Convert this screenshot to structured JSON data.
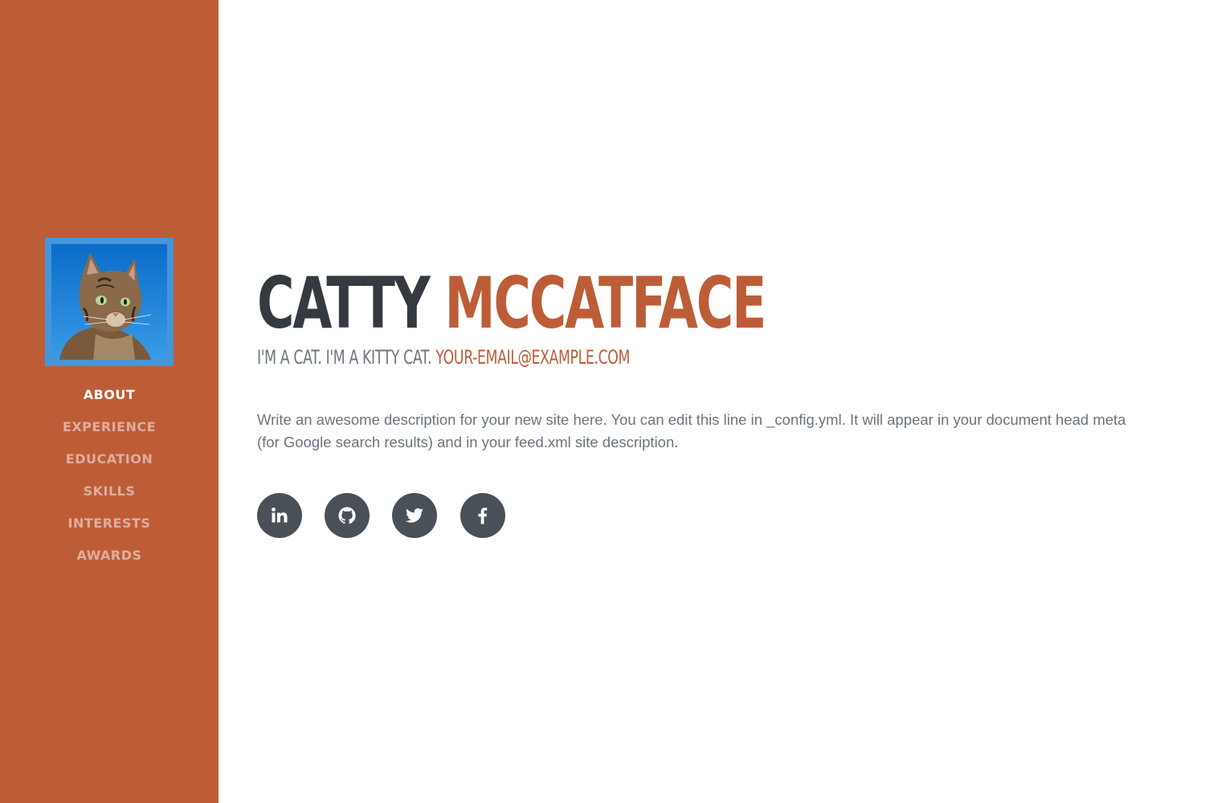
{
  "profile": {
    "first_name": "Catty",
    "last_name": "McCatface",
    "tagline": "I'm a cat. I'm a kitty cat.",
    "email": "your-email@example.com",
    "description": "Write an awesome description for your new site here. You can edit this line in _config.yml. It will appear in your document head meta (for Google search results) and in your feed.xml site description.",
    "avatar_icon": "cat-photo"
  },
  "nav": {
    "items": [
      {
        "label": "About",
        "active": true
      },
      {
        "label": "Experience",
        "active": false
      },
      {
        "label": "Education",
        "active": false
      },
      {
        "label": "Skills",
        "active": false
      },
      {
        "label": "Interests",
        "active": false
      },
      {
        "label": "Awards",
        "active": false
      }
    ]
  },
  "social": [
    {
      "icon": "linkedin-icon"
    },
    {
      "icon": "github-icon"
    },
    {
      "icon": "twitter-icon"
    },
    {
      "icon": "facebook-icon"
    }
  ],
  "colors": {
    "primary": "#bd5d38",
    "heading": "#343a40",
    "muted": "#6c757d",
    "social_bg": "#495057"
  }
}
